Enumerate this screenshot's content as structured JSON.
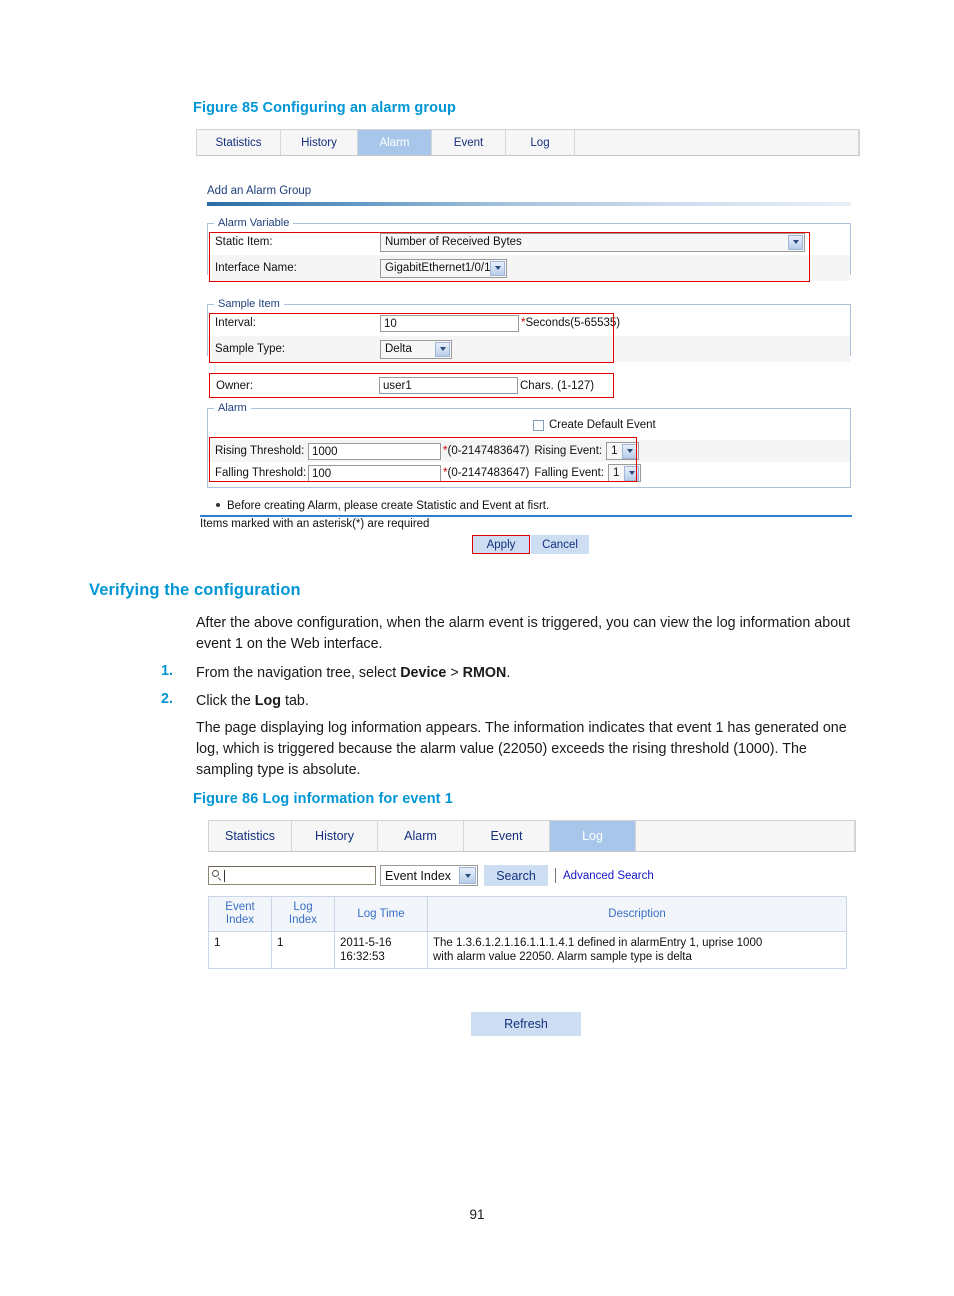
{
  "page": {
    "number": "91"
  },
  "figure85": {
    "caption": "Figure 85 Configuring an alarm group",
    "tabs": [
      {
        "label": "Statistics",
        "active": false
      },
      {
        "label": "History",
        "active": false
      },
      {
        "label": "Alarm",
        "active": true
      },
      {
        "label": "Event",
        "active": false
      },
      {
        "label": "Log",
        "active": false
      }
    ],
    "panel_title": "Add an Alarm Group",
    "alarm_variable": {
      "legend": "Alarm Variable",
      "static_item_label": "Static Item:",
      "static_item_value": "Number of Received Bytes",
      "interface_name_label": "Interface Name:",
      "interface_name_value": "GigabitEthernet1/0/1"
    },
    "sample_item": {
      "legend": "Sample Item",
      "interval_label": "Interval:",
      "interval_value": "10",
      "interval_hint_star": "*",
      "interval_hint": "Seconds(5-65535)",
      "sample_type_label": "Sample Type:",
      "sample_type_value": "Delta"
    },
    "owner": {
      "label": "Owner:",
      "value": "user1",
      "hint": "Chars. (1-127)"
    },
    "alarm": {
      "legend": "Alarm",
      "create_default_event_label": "Create Default Event",
      "create_default_event_checked": false,
      "rising_threshold_label": "Rising Threshold:",
      "rising_threshold_value": "1000",
      "rising_hint_star": "*",
      "rising_hint": "(0-2147483647)",
      "rising_event_label": "Rising Event:",
      "rising_event_value": "1",
      "falling_threshold_label": "Falling Threshold:",
      "falling_threshold_value": "100",
      "falling_hint_star": "*",
      "falling_hint": "(0-2147483647)",
      "falling_event_label": "Falling Event:",
      "falling_event_value": "1"
    },
    "bullet_note": "Before creating Alarm, please create Statistic and Event at fisrt.",
    "required_note": "Items marked with an asterisk(*) are required",
    "apply_label": "Apply",
    "cancel_label": "Cancel"
  },
  "section": {
    "heading": "Verifying the configuration",
    "intro": "After the above configuration, when the alarm event is triggered, you can view the log information about event 1 on the Web interface.",
    "steps": [
      {
        "num": "1.",
        "prefix": "From the navigation tree, select ",
        "bold1": "Device",
        "mid": " > ",
        "bold2": "RMON",
        "suffix": "."
      },
      {
        "num": "2.",
        "prefix": "Click the ",
        "bold1": "Log",
        "mid": "",
        "bold2": "",
        "suffix": " tab."
      }
    ],
    "result": "The page displaying log information appears. The information indicates that event 1 has generated one log, which is triggered because the alarm value (22050) exceeds the rising threshold (1000). The sampling type is absolute."
  },
  "figure86": {
    "caption": "Figure 86 Log information for event 1",
    "tabs": [
      {
        "label": "Statistics",
        "active": false
      },
      {
        "label": "History",
        "active": false
      },
      {
        "label": "Alarm",
        "active": false
      },
      {
        "label": "Event",
        "active": false
      },
      {
        "label": "Log",
        "active": true
      }
    ],
    "search": {
      "input_value": "",
      "placeholder": "",
      "field_selector_value": "Event Index",
      "search_button_label": "Search",
      "advanced_search_label": "Advanced Search"
    },
    "table": {
      "headers": [
        "Event Index",
        "Log Index",
        "Log Time",
        "Description"
      ],
      "headers_wrapped": [
        {
          "line1": "Event",
          "line2": "Index"
        },
        {
          "line1": "Log",
          "line2": "Index"
        },
        {
          "line1": "Log Time",
          "line2": ""
        },
        {
          "line1": "Description",
          "line2": ""
        }
      ],
      "rows": [
        {
          "event_index": "1",
          "log_index": "1",
          "log_time_line1": "2011-5-16",
          "log_time_line2": "16:32:53",
          "description_line1": "The 1.3.6.1.2.1.16.1.1.1.4.1 defined in alarmEntry 1, uprise 1000",
          "description_line2": "with alarm value 22050. Alarm sample type is delta"
        }
      ]
    },
    "refresh_label": "Refresh"
  },
  "colors": {
    "accent_blue": "#0096d6",
    "tab_active": "#a8c6ea",
    "highlight_red": "#e00000",
    "link_blue": "#1414c8"
  }
}
